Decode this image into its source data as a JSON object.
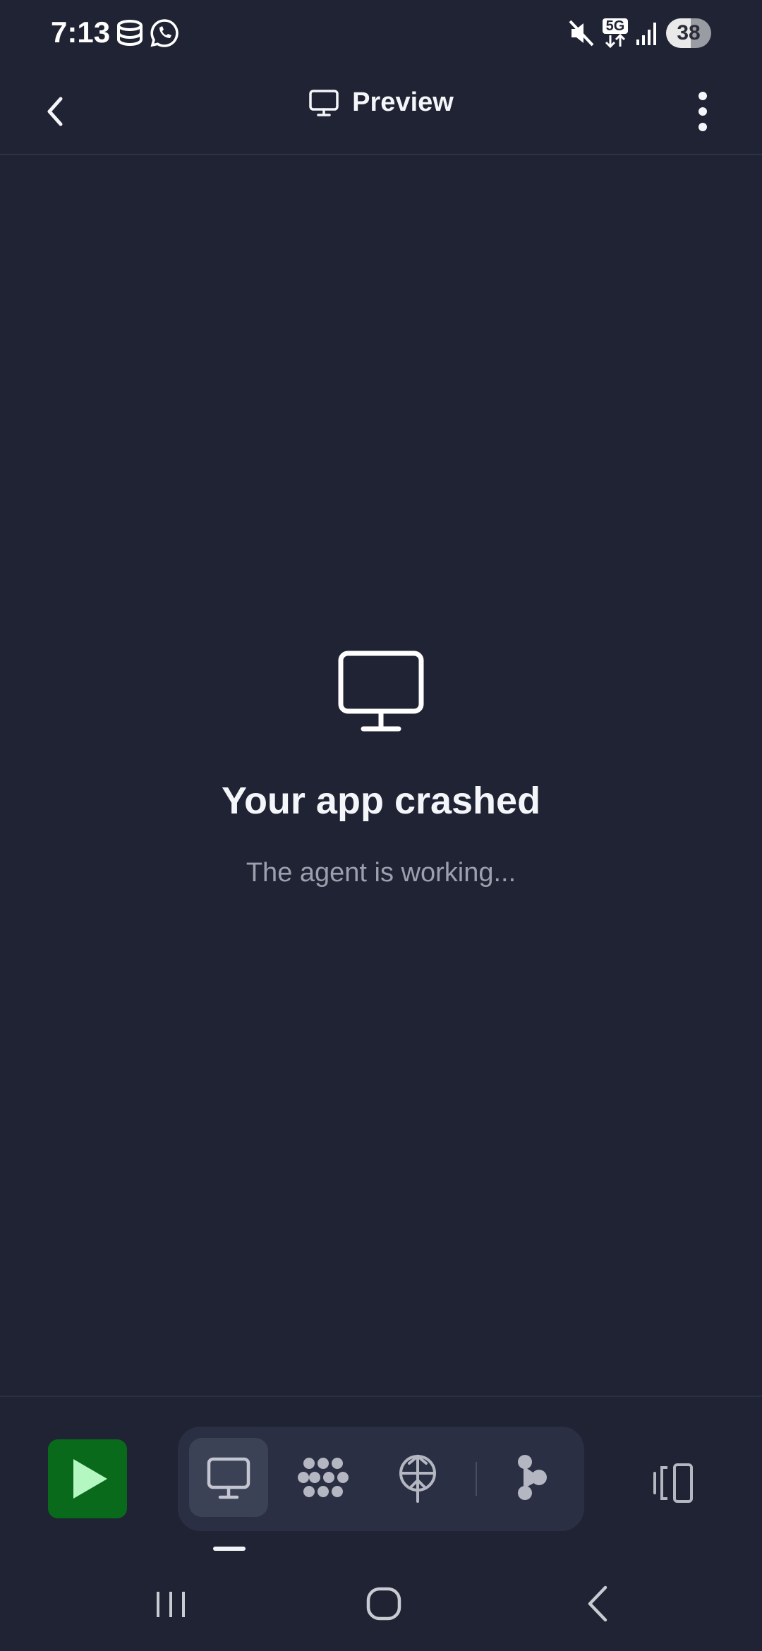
{
  "status_bar": {
    "time": "7:13",
    "network": "5G",
    "battery": "38",
    "icons": [
      "storage-icon",
      "whatsapp-icon",
      "mute-icon",
      "5g-data-icon",
      "signal-icon"
    ]
  },
  "header": {
    "title": "Preview",
    "icons": [
      "back-arrow-icon",
      "monitor-icon",
      "more-vertical-icon"
    ]
  },
  "main": {
    "title": "Your app crashed",
    "subtitle": "The agent is working..."
  },
  "toolbar": {
    "run_icon": "play-icon",
    "tabs": [
      {
        "icon": "monitor-icon",
        "active": true
      },
      {
        "icon": "workflows-icon",
        "active": false
      },
      {
        "icon": "deploy-icon",
        "active": false
      },
      {
        "icon": "git-branch-icon",
        "active": false
      }
    ],
    "devices_icon": "devices-icon"
  },
  "nav_bar": {
    "icons": [
      "recents-icon",
      "home-icon",
      "back-icon"
    ]
  },
  "colors": {
    "background": "#1f2333",
    "run_button": "#0a6a1b",
    "run_icon": "#b5f7c0",
    "tab_group": "#2a2f43",
    "tab_active": "#3b4256",
    "muted_text": "#9ba0ad"
  }
}
